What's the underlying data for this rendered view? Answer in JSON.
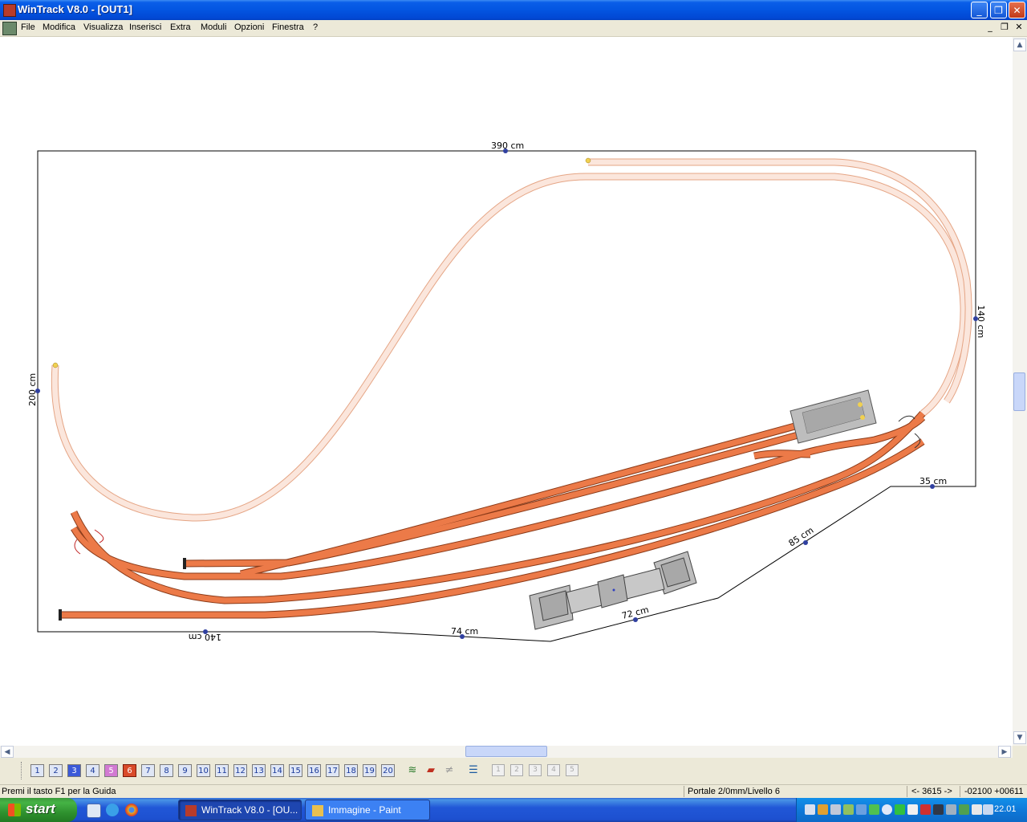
{
  "window": {
    "title": "WinTrack  V8.0 - [OUT1]"
  },
  "menu": [
    "File",
    "Modifica",
    "Visualizza",
    "Inserisci",
    "Extra",
    "Moduli",
    "Opzioni",
    "Finestra",
    "?"
  ],
  "dimensions": {
    "top": "390 cm",
    "left": "200 cm",
    "right": "140 cm",
    "bottom_left": "140 cm",
    "bottom_mid": "74 cm",
    "bottom_right": "72 cm",
    "diagonal": "85 cm",
    "step": "35 cm"
  },
  "layers": [
    "1",
    "2",
    "3",
    "4",
    "5",
    "6",
    "7",
    "8",
    "9",
    "10",
    "11",
    "12",
    "13",
    "14",
    "15",
    "16",
    "17",
    "18",
    "19",
    "20"
  ],
  "active_layer": "6",
  "gray_buttons": [
    "1",
    "2",
    "3",
    "4",
    "5"
  ],
  "status": {
    "hint": "Premi il tasto F1 per la Guida",
    "level": "Portale 2/0mm/Livello 6",
    "nav": "<- 3615 ->",
    "coords": "-02100  +00611"
  },
  "taskbar": {
    "start": "start",
    "tasks": [
      "WinTrack  V8.0 - [OU...",
      "Immagine - Paint"
    ],
    "clock": "22.01"
  },
  "colors": {
    "track_main": "#e8703e",
    "track_upper": "#f8d8c8",
    "titlebar": "#0355e1",
    "taskbar": "#245edb"
  }
}
